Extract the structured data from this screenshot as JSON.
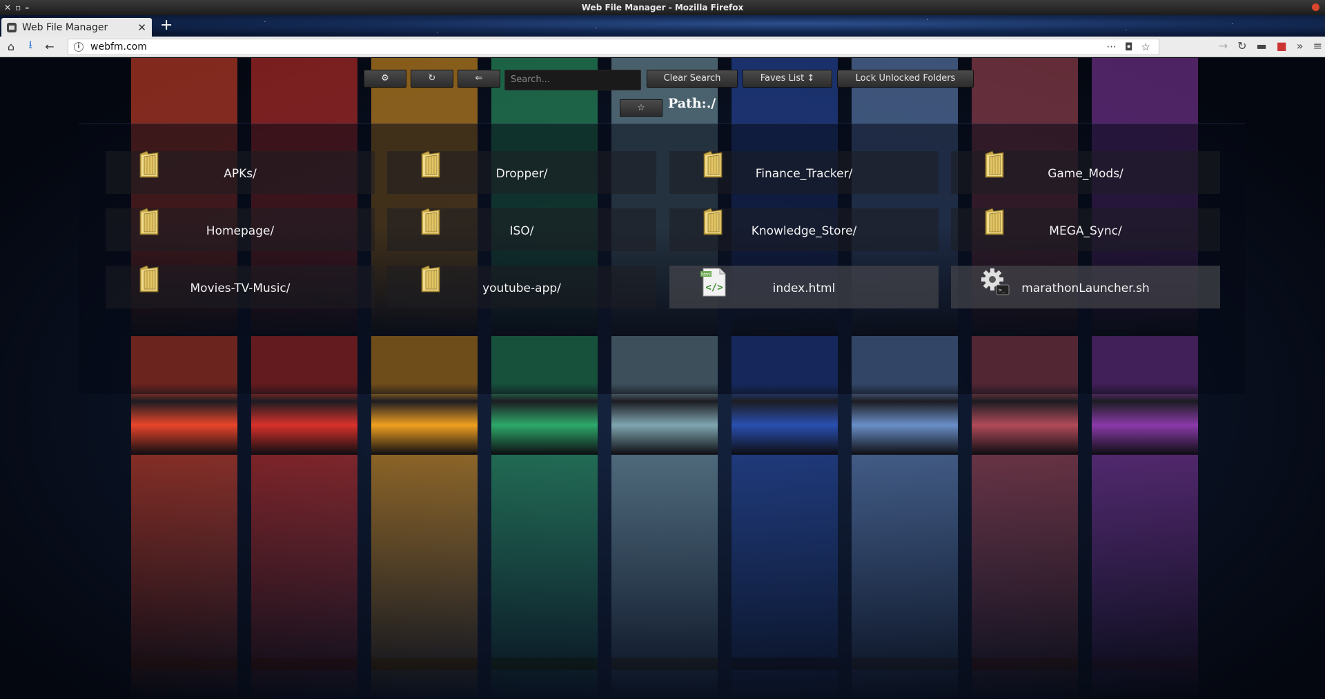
{
  "window": {
    "title": "Web File Manager - Mozilla Firefox"
  },
  "browser": {
    "tab_title": "Web File Manager",
    "url": "webfm.com"
  },
  "toolbar": {
    "settings_label": "⚙",
    "refresh_label": "↻",
    "back_label": "⇐",
    "search_placeholder": "Search...",
    "clear_search_label": "Clear Search",
    "faves_label": "Faves List ↕",
    "lock_label": "Lock Unlocked Folders",
    "star_label": "☆",
    "path_label": "Path:./"
  },
  "entries": [
    {
      "name": "APKs/",
      "type": "folder"
    },
    {
      "name": "Dropper/",
      "type": "folder"
    },
    {
      "name": "Finance_Tracker/",
      "type": "folder"
    },
    {
      "name": "Game_Mods/",
      "type": "folder"
    },
    {
      "name": "Homepage/",
      "type": "folder"
    },
    {
      "name": "ISO/",
      "type": "folder"
    },
    {
      "name": "Knowledge_Store/",
      "type": "folder"
    },
    {
      "name": "MEGA_Sync/",
      "type": "folder"
    },
    {
      "name": "Movies-TV-Music/",
      "type": "folder"
    },
    {
      "name": "youtube-app/",
      "type": "folder"
    },
    {
      "name": "index.html",
      "type": "html"
    },
    {
      "name": "marathonLauncher.sh",
      "type": "script"
    }
  ],
  "wallpaper_colors": [
    "#e8452a",
    "#d8312a",
    "#f0a020",
    "#2ea86a",
    "#7fa5b0",
    "#2a4fb0",
    "#6a8fc8",
    "#b04a58",
    "#8a3aa8"
  ]
}
